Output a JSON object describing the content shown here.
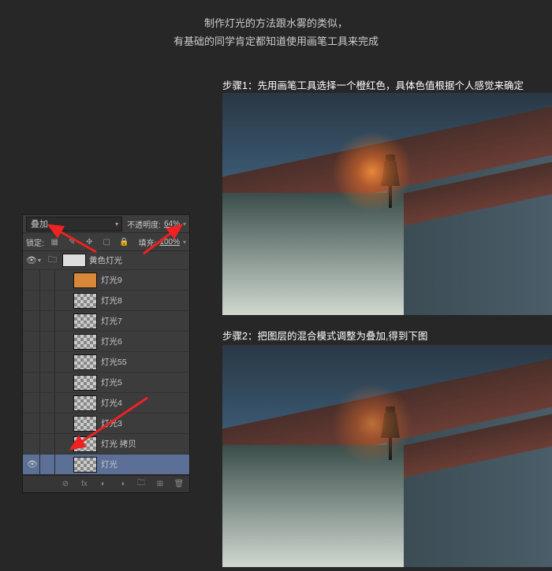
{
  "intro": {
    "line1": "制作灯光的方法跟水雾的类似，",
    "line2": "有基础的同学肯定都知道使用画笔工具来完成"
  },
  "steps": {
    "s1": "步骤1：先用画笔工具选择一个橙红色，具体色值根据个人感觉来确定",
    "s2": "步骤2：把图层的混合模式调整为叠加,得到下图"
  },
  "panel": {
    "blend_mode": "叠加",
    "opacity_label": "不透明度:",
    "opacity_value": "64%",
    "lock_label": "锁定:",
    "fill_label": "填充:",
    "fill_value": "100%",
    "group_name": "黄色灯光",
    "layers": [
      {
        "name": "灯光9",
        "thumb": "orange",
        "visible": false
      },
      {
        "name": "灯光8",
        "thumb": "trans",
        "visible": false
      },
      {
        "name": "灯光7",
        "thumb": "trans",
        "visible": false
      },
      {
        "name": "灯光6",
        "thumb": "trans",
        "visible": false
      },
      {
        "name": "灯光55",
        "thumb": "trans",
        "visible": false
      },
      {
        "name": "灯光5",
        "thumb": "trans",
        "visible": false
      },
      {
        "name": "灯光4",
        "thumb": "trans",
        "visible": false
      },
      {
        "name": "灯光3",
        "thumb": "trans",
        "visible": false
      },
      {
        "name": "灯光 拷贝",
        "thumb": "trans",
        "visible": false
      },
      {
        "name": "灯光",
        "thumb": "trans",
        "visible": true,
        "selected": true
      }
    ]
  }
}
